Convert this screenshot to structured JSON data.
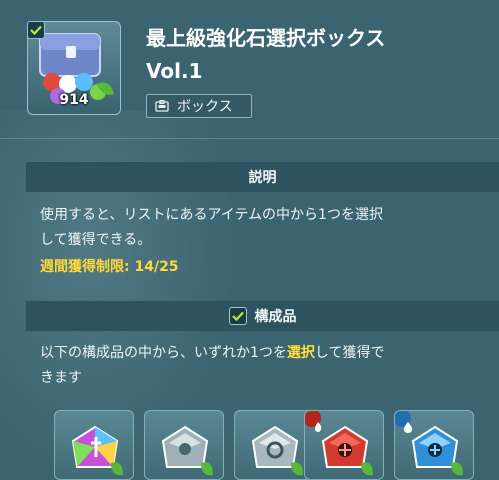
{
  "item": {
    "title": "最上級強化石選択ボックス",
    "subtitle": "Vol.1",
    "count": "914",
    "type_label": "ボックス",
    "icon": "chest-icon"
  },
  "description_section": {
    "header": "説明",
    "text_line1": "使用すると、リストにあるアイテムの中から1つを選択",
    "text_line2": "して獲得できる。",
    "limit_label": "週間獲得制限: 14/25"
  },
  "components_section": {
    "header": "構成品",
    "text_before": "以下の構成品の中から、いずれか1つを",
    "text_highlight": "選択",
    "text_after": "して獲得で",
    "text_line2": "きます"
  },
  "slots": [
    {
      "name": "rainbow-stone",
      "color": "#c84fd8",
      "badge": ""
    },
    {
      "name": "silver-stone-a",
      "color": "#9fb0b8",
      "badge": ""
    },
    {
      "name": "silver-stone-b",
      "color": "#a7b8bf",
      "badge": ""
    },
    {
      "name": "fire-stone",
      "color": "#d13a2c",
      "badge": "fire-icon"
    },
    {
      "name": "water-stone",
      "color": "#2f8fd8",
      "badge": "water-icon"
    }
  ],
  "colors": {
    "background": "#3c6470",
    "section_header": "#2d5360",
    "highlight": "#ffe13a"
  }
}
